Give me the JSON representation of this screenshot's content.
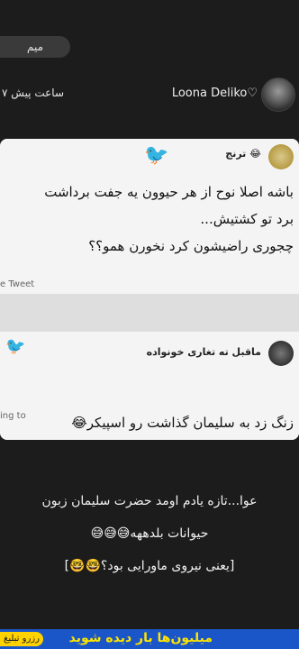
{
  "chip": {
    "label": "میم"
  },
  "post": {
    "time": "۷ ساعت پیش",
    "author": "Loona Deliko♡"
  },
  "image": {
    "tweet1": {
      "handle": "ترنج 😂",
      "line1": "باشه اصلا نوح از هر حیوون یه جفت برداشت",
      "line2": "برد تو کشتیش...",
      "line3": "چجوری راضیشون کرد نخورن همو؟؟",
      "footer": "e Tweet"
    },
    "tweet2": {
      "handle": "ماقبل ته تغاری خونواده",
      "replying": "ing to",
      "line1": "زنگ زد به سلیمان گذاشت رو اسپیکر😂"
    }
  },
  "caption": {
    "line1": "عوا...تازه یادم اومد حضرت سلیمان زبون",
    "line2": "حیوانات بلدههه😅😅😅",
    "line3": "[یعنی نیروی ماورایی بود؟🤓🤓]"
  },
  "ad": {
    "text": "میلیون‌ها بار دیده شوید",
    "tag": "رزرو تبلیغ"
  }
}
